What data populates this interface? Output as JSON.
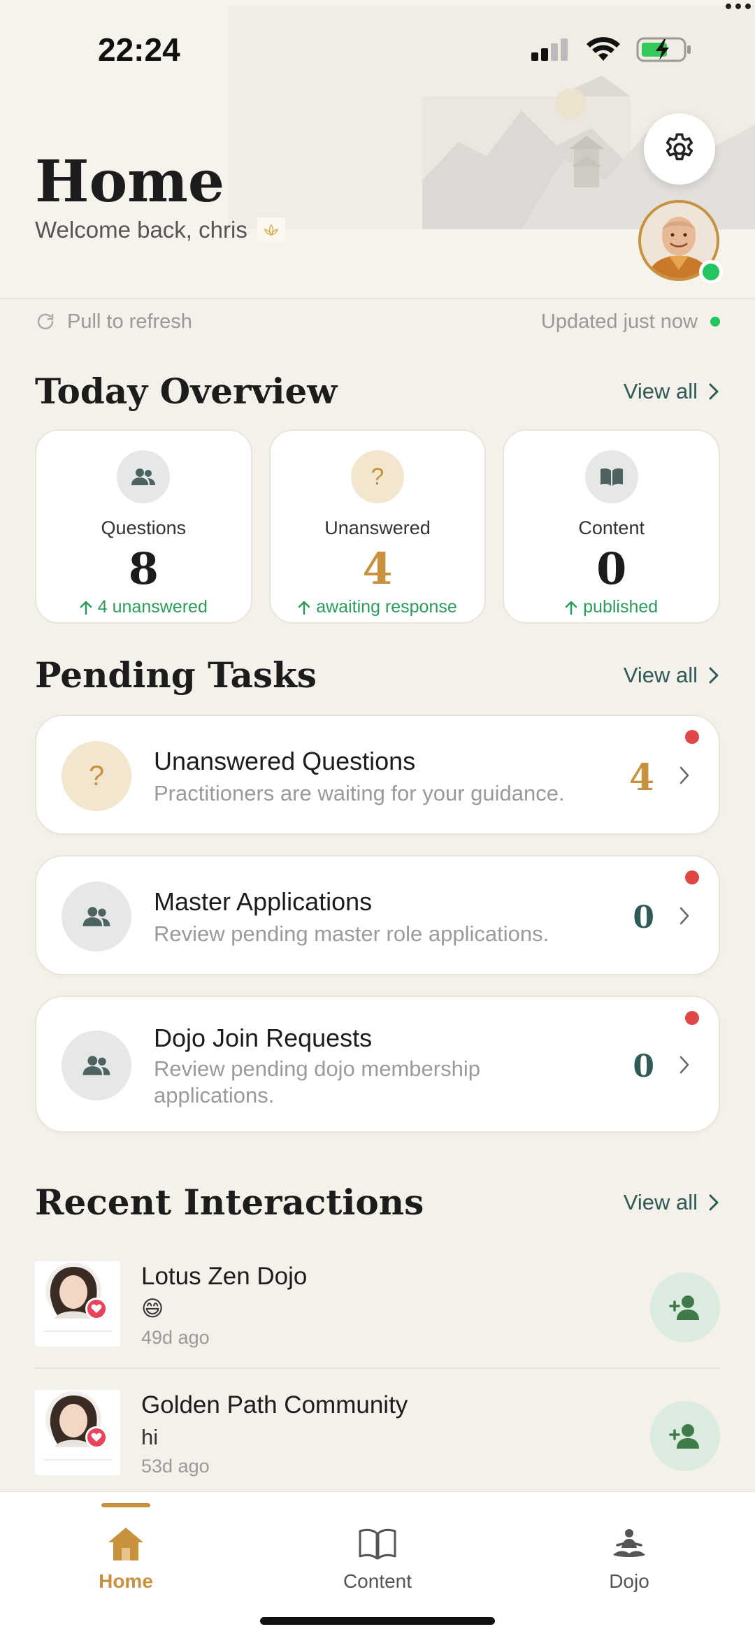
{
  "status_bar": {
    "time": "22:24"
  },
  "header": {
    "title": "Home",
    "welcome": "Welcome back, chris"
  },
  "refresh": {
    "pull_label": "Pull to refresh",
    "updated_label": "Updated just now"
  },
  "overview": {
    "title": "Today Overview",
    "view_all": "View all",
    "cards": [
      {
        "label": "Questions",
        "value": "8",
        "sub": "4 unanswered",
        "icon": "people-icon"
      },
      {
        "label": "Unanswered",
        "value": "4",
        "sub": "awaiting response",
        "icon": "question-icon"
      },
      {
        "label": "Content",
        "value": "0",
        "sub": "published",
        "icon": "book-icon"
      }
    ]
  },
  "pending": {
    "title": "Pending Tasks",
    "view_all": "View all",
    "tasks": [
      {
        "title": "Unanswered Questions",
        "desc": "Practitioners are waiting for your guidance.",
        "count": "4"
      },
      {
        "title": "Master Applications",
        "desc": "Review pending master role applications.",
        "count": "0"
      },
      {
        "title": "Dojo Join Requests",
        "desc": "Review pending dojo membership applications.",
        "count": "0"
      }
    ]
  },
  "recent": {
    "title": "Recent Interactions",
    "view_all": "View all",
    "items": [
      {
        "title": "Lotus Zen Dojo",
        "message": "😄",
        "time": "49d ago"
      },
      {
        "title": "Golden Path Community",
        "message": "hi",
        "time": "53d ago"
      }
    ]
  },
  "nav": {
    "items": [
      {
        "label": "Home",
        "icon": "home-icon",
        "active": true
      },
      {
        "label": "Content",
        "icon": "book-open-icon",
        "active": false
      },
      {
        "label": "Dojo",
        "icon": "meditation-icon",
        "active": false
      }
    ]
  },
  "colors": {
    "accent_gold": "#c8913e",
    "teal": "#2f5a57",
    "green": "#2a9d5a",
    "badge_red": "#e04848"
  }
}
